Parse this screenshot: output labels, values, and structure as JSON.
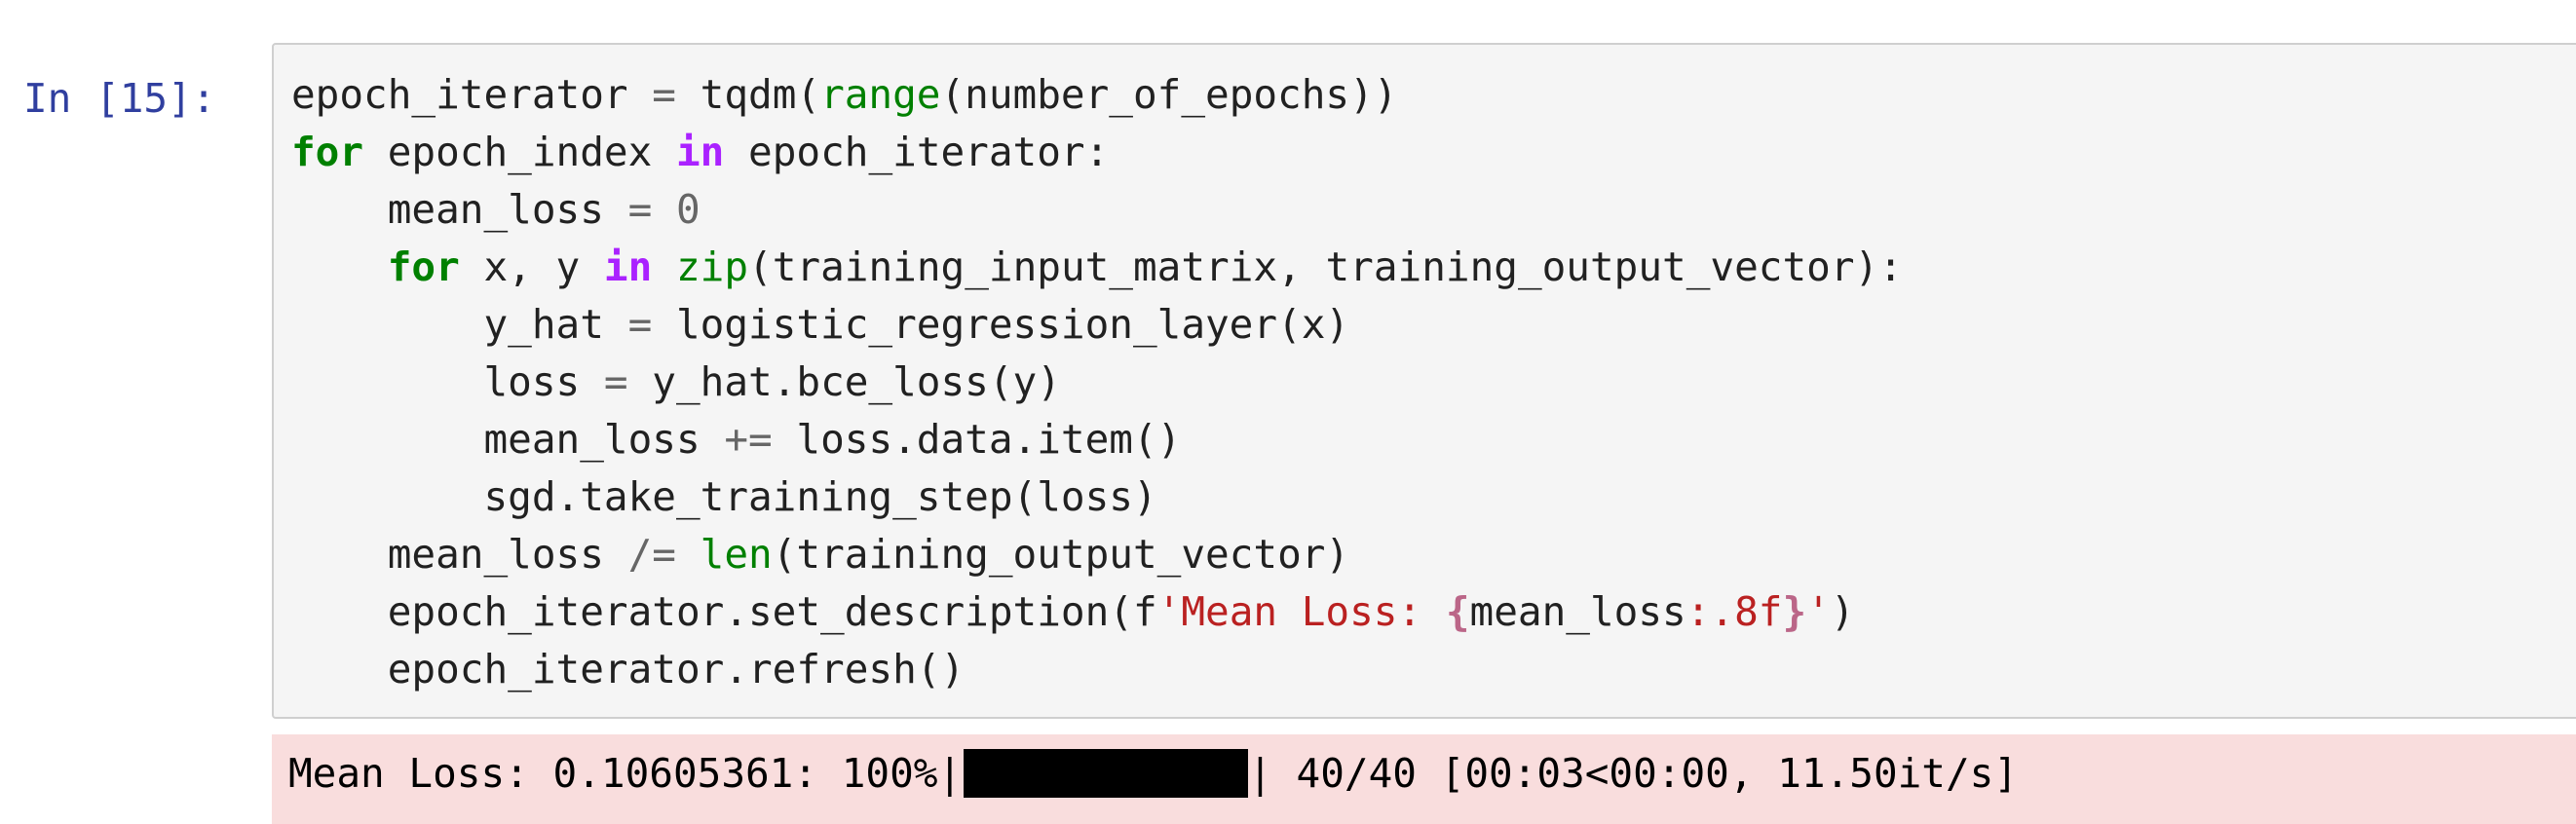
{
  "cell": {
    "prompt": "In [15]:",
    "code_lines": [
      [
        {
          "t": "epoch_iterator ",
          "c": "plain"
        },
        {
          "t": "=",
          "c": "op"
        },
        {
          "t": " tqdm(",
          "c": "plain"
        },
        {
          "t": "range",
          "c": "bi"
        },
        {
          "t": "(number_of_epochs))",
          "c": "plain"
        }
      ],
      [
        {
          "t": "for",
          "c": "kw"
        },
        {
          "t": " epoch_index ",
          "c": "plain"
        },
        {
          "t": "in",
          "c": "ow"
        },
        {
          "t": " epoch_iterator:",
          "c": "plain"
        }
      ],
      [
        {
          "t": "    mean_loss ",
          "c": "plain"
        },
        {
          "t": "=",
          "c": "op"
        },
        {
          "t": " ",
          "c": "plain"
        },
        {
          "t": "0",
          "c": "num"
        }
      ],
      [
        {
          "t": "    ",
          "c": "plain"
        },
        {
          "t": "for",
          "c": "kw"
        },
        {
          "t": " x, y ",
          "c": "plain"
        },
        {
          "t": "in",
          "c": "ow"
        },
        {
          "t": " ",
          "c": "plain"
        },
        {
          "t": "zip",
          "c": "bi"
        },
        {
          "t": "(training_input_matrix, training_output_vector):",
          "c": "plain"
        }
      ],
      [
        {
          "t": "        y_hat ",
          "c": "plain"
        },
        {
          "t": "=",
          "c": "op"
        },
        {
          "t": " logistic_regression_layer(x)",
          "c": "plain"
        }
      ],
      [
        {
          "t": "        loss ",
          "c": "plain"
        },
        {
          "t": "=",
          "c": "op"
        },
        {
          "t": " y_hat.bce_loss(y)",
          "c": "plain"
        }
      ],
      [
        {
          "t": "        mean_loss ",
          "c": "plain"
        },
        {
          "t": "+=",
          "c": "op"
        },
        {
          "t": " loss.data.item()",
          "c": "plain"
        }
      ],
      [
        {
          "t": "        sgd.take_training_step(loss)",
          "c": "plain"
        }
      ],
      [
        {
          "t": "    mean_loss ",
          "c": "plain"
        },
        {
          "t": "/=",
          "c": "op"
        },
        {
          "t": " ",
          "c": "plain"
        },
        {
          "t": "len",
          "c": "bi"
        },
        {
          "t": "(training_output_vector)",
          "c": "plain"
        }
      ],
      [
        {
          "t": "    epoch_iterator.set_description(f",
          "c": "plain"
        },
        {
          "t": "'Mean Loss: ",
          "c": "str"
        },
        {
          "t": "{",
          "c": "interp"
        },
        {
          "t": "mean_loss",
          "c": "plain"
        },
        {
          "t": ":.8f",
          "c": "str"
        },
        {
          "t": "}",
          "c": "interp"
        },
        {
          "t": "'",
          "c": "str"
        },
        {
          "t": ")",
          "c": "plain"
        }
      ],
      [
        {
          "t": "    epoch_iterator.refresh()",
          "c": "plain"
        }
      ]
    ]
  },
  "output": {
    "prefix": "Mean Loss: 0.10605361: 100%|",
    "suffix": "| 40/40 [00:03<00:00, 11.50it/s]",
    "progress_fraction": 1.0
  },
  "colors": {
    "prompt": "#303f9f",
    "keyword": "#008000",
    "operator_word": "#aa22ff",
    "builtin": "#008000",
    "string": "#ba2121",
    "number": "#666666",
    "output_background": "#f9dddd",
    "input_background": "#f5f5f5"
  }
}
